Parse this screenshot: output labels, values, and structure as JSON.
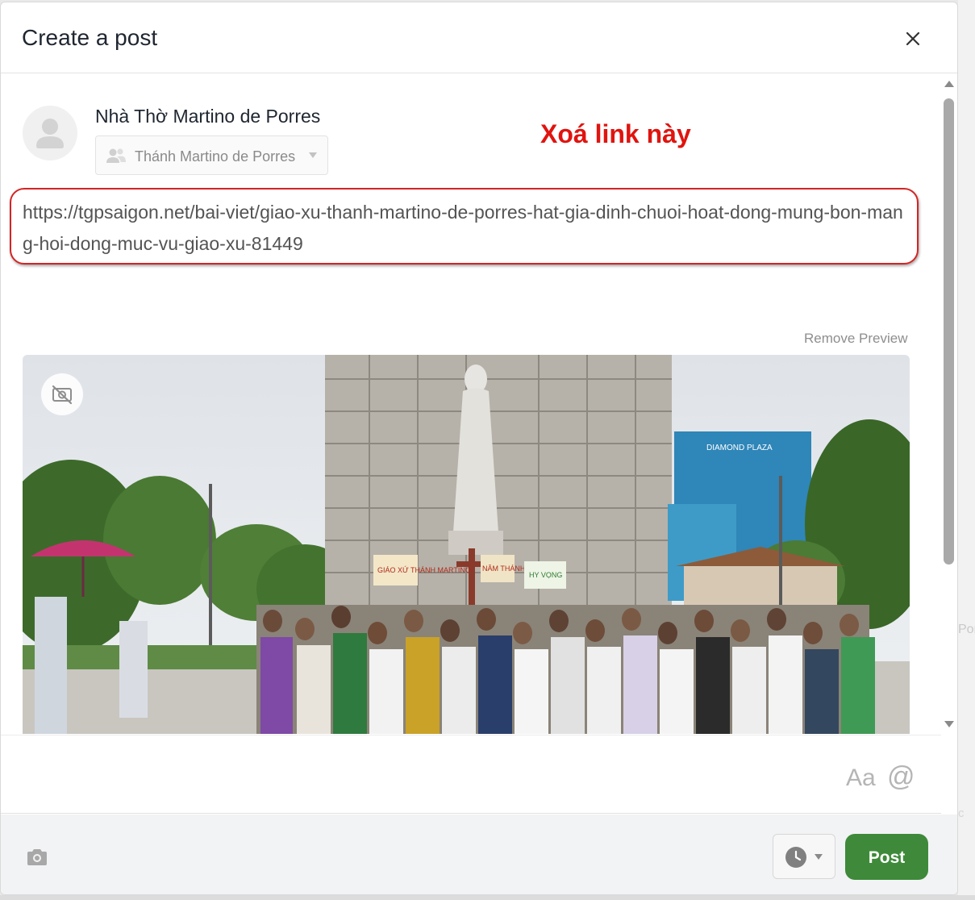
{
  "dialog": {
    "title": "Create a post",
    "close_icon": "close-icon"
  },
  "author": {
    "name": "Nhà Thờ Martino de Porres",
    "avatar_icon": "user-avatar-icon",
    "audience": {
      "label": "Thánh Martino de Porres",
      "icon": "people-icon"
    }
  },
  "annotation": {
    "text": "Xoá link này",
    "color": "#e0140f"
  },
  "post_text": "https://tgpsaigon.net/bai-viet/giao-xu-thanh-martino-de-porres-hat-gia-dinh-chuoi-hoat-dong-mung-bon-mang-hoi-dong-muc-vu-giao-xu-81449",
  "link_preview": {
    "remove_label": "Remove Preview",
    "hide_image_icon": "no-image-icon",
    "image_signs": [
      "DIAMOND PLAZA",
      "GIÁO XỨ THÁNH MARTINO",
      "NĂM THÁNH",
      "HY VỌNG"
    ]
  },
  "editor_tools": {
    "format_label": "Aa",
    "mention_label": "@"
  },
  "footer": {
    "camera_icon": "camera-icon",
    "schedule_icon": "clock-icon",
    "post_label": "Post"
  },
  "colors": {
    "post_button": "#3e8a3a",
    "highlight": "#d42424"
  }
}
